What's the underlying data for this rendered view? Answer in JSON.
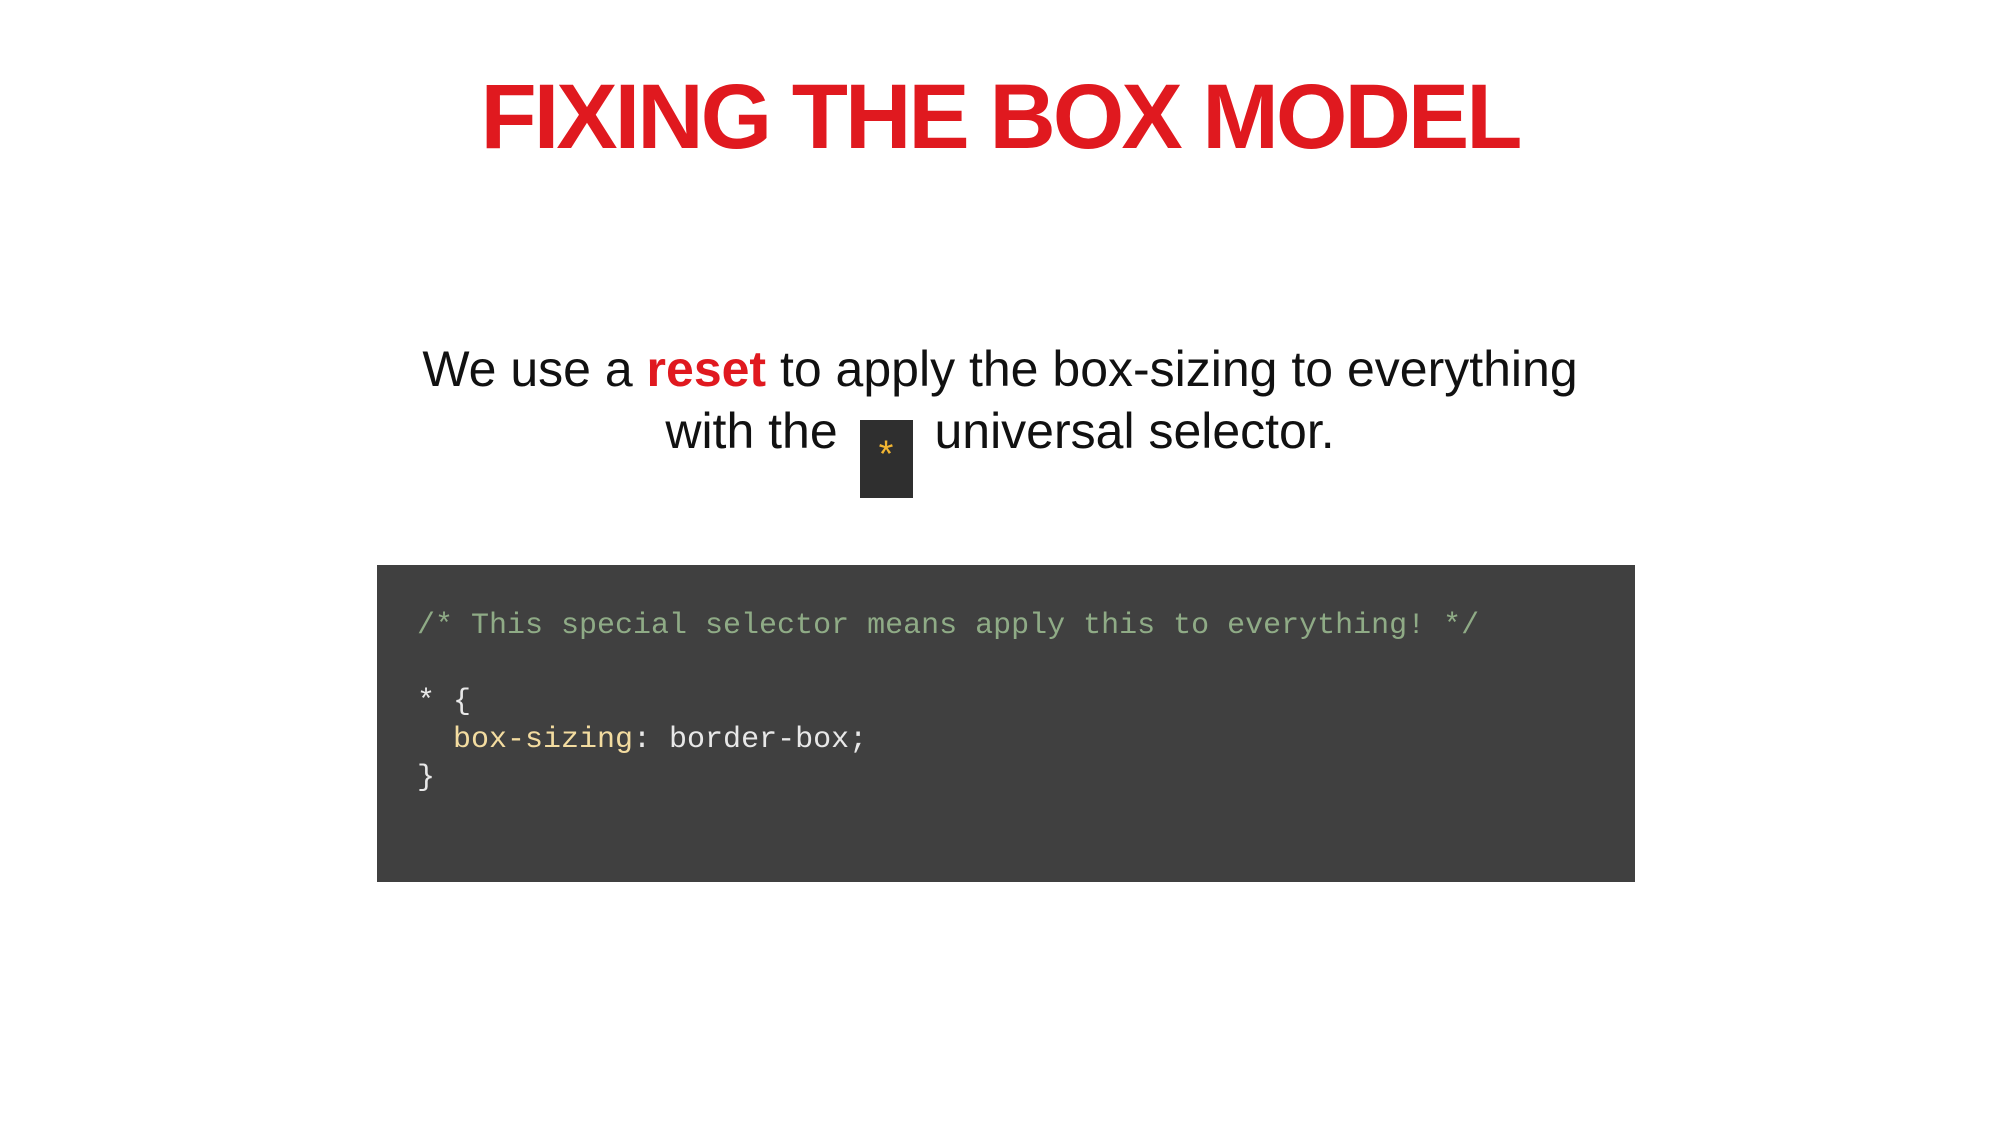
{
  "slide": {
    "title": "FIXING THE BOX MODEL",
    "intro": {
      "part1": "We use a ",
      "highlight": "reset",
      "part2": " to apply the box-sizing to everything",
      "part3": "with the ",
      "inline_code": "*",
      "part4": " universal selector."
    },
    "code": {
      "comment": "/* This special selector means apply this to everything! */",
      "selector_open": "* {",
      "indent": "  ",
      "property": "box-sizing",
      "value": ": border-box;",
      "close": "}"
    },
    "colors": {
      "accent": "#e0191f",
      "code_bg": "#404040",
      "comment": "#8fab86",
      "property": "#f3dca0",
      "inline_code_fg": "#f2b632"
    }
  }
}
